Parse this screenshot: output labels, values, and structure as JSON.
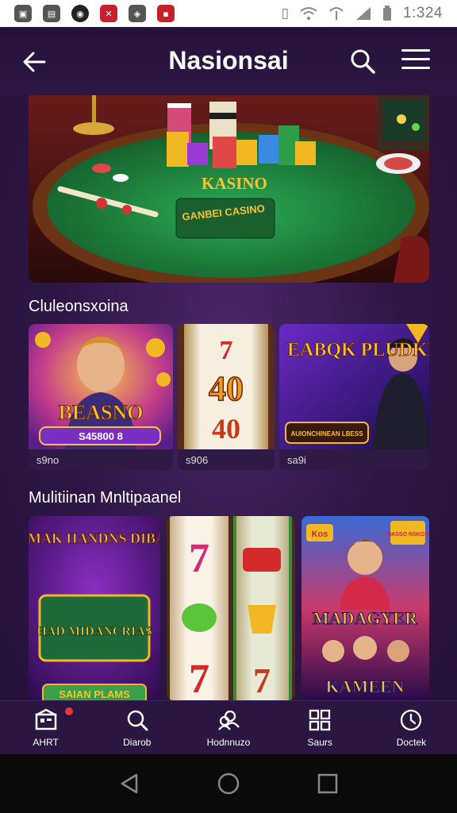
{
  "status_bar": {
    "time": "1:324",
    "apps": [
      "▣",
      "▤",
      "◉",
      "✕",
      "◈",
      "▪"
    ],
    "icons": [
      "vibrate-icon",
      "wifi-icon",
      "data-icon",
      "signal-icon",
      "battery-icon"
    ]
  },
  "header": {
    "title": "Nasionsai",
    "back_icon": "arrow-left-icon",
    "search_icon": "search-icon",
    "menu_icon": "hamburger-menu-icon"
  },
  "hero": {
    "table_label": "KASINO",
    "plate_label": "GANBEI CASINO"
  },
  "sections": [
    {
      "title": "Cluleonsxoina",
      "cards": [
        {
          "art_title": "BEASNO",
          "art_sub": "S45800 8",
          "caption": "s9no"
        },
        {
          "art_reels": [
            "7",
            "40",
            "40"
          ],
          "caption": "s906"
        },
        {
          "art_title": "EABQK PLUDKE DOMIS",
          "art_sub": "AUIONCHINEAN LBESS",
          "caption": "sa9i"
        }
      ]
    },
    {
      "title": "Mulitiinan Mnltipaanel",
      "cards": [
        {
          "art_title": "SILMAK HANDNS DIBANS",
          "art_title2": "HAD MIDANCRIAS",
          "art_sub": "SAIAN PLAMS"
        },
        {
          "art_reels": [
            "7",
            "7",
            "7"
          ]
        },
        {
          "art_badge_left": "Kos",
          "art_badge_right": "NASSO NSKOS",
          "art_title": "MADAGYER",
          "art_title2": "KAMEEN"
        }
      ]
    }
  ],
  "bottom_nav": [
    {
      "label": "AHRT",
      "icon": "home-icon",
      "badge": true
    },
    {
      "label": "Diarob",
      "icon": "search-icon"
    },
    {
      "label": "Hodnnuzo",
      "icon": "users-icon"
    },
    {
      "label": "Saurs",
      "icon": "grid-icon"
    },
    {
      "label": "Doctek",
      "icon": "clock-icon"
    }
  ],
  "system_nav": [
    "back-triangle-icon",
    "home-circle-icon",
    "recents-square-icon"
  ],
  "colors": {
    "background": "#2a1540",
    "accent_purple": "#6a2fa0",
    "gold": "#f2b824",
    "felt_green": "#1f7a3a"
  }
}
